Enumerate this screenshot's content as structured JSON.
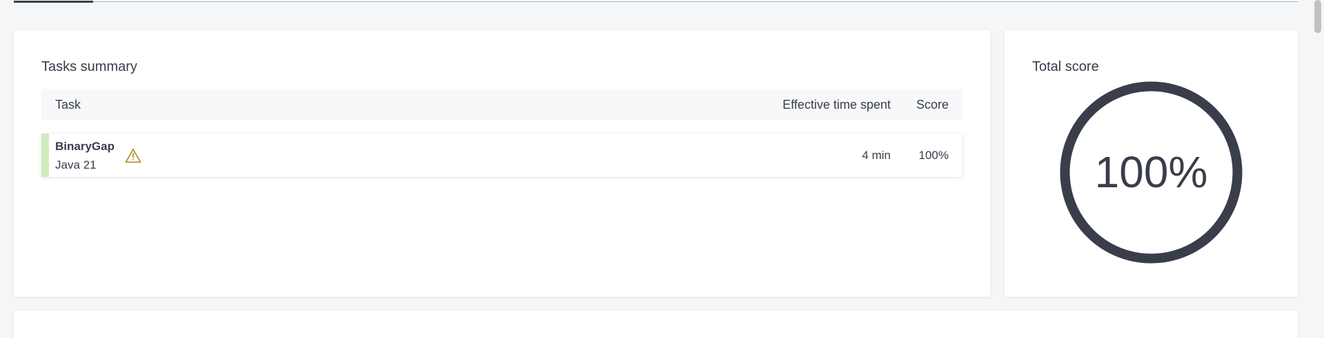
{
  "tasks_summary": {
    "title": "Tasks summary",
    "columns": {
      "task": "Task",
      "time": "Effective time spent",
      "score": "Score"
    },
    "rows": [
      {
        "name": "BinaryGap",
        "language": "Java 21",
        "time": "4 min",
        "score": "100%",
        "status_color": "#d0ecbc",
        "warning_icon": "warning-icon"
      }
    ]
  },
  "total_score": {
    "title": "Total score",
    "value": "100%",
    "fraction": 1.0,
    "ring_color": "#3a3d4a"
  },
  "colors": {
    "warning": "#b8860b",
    "accent_success": "#d0ecbc",
    "text": "#3a3d4a"
  }
}
